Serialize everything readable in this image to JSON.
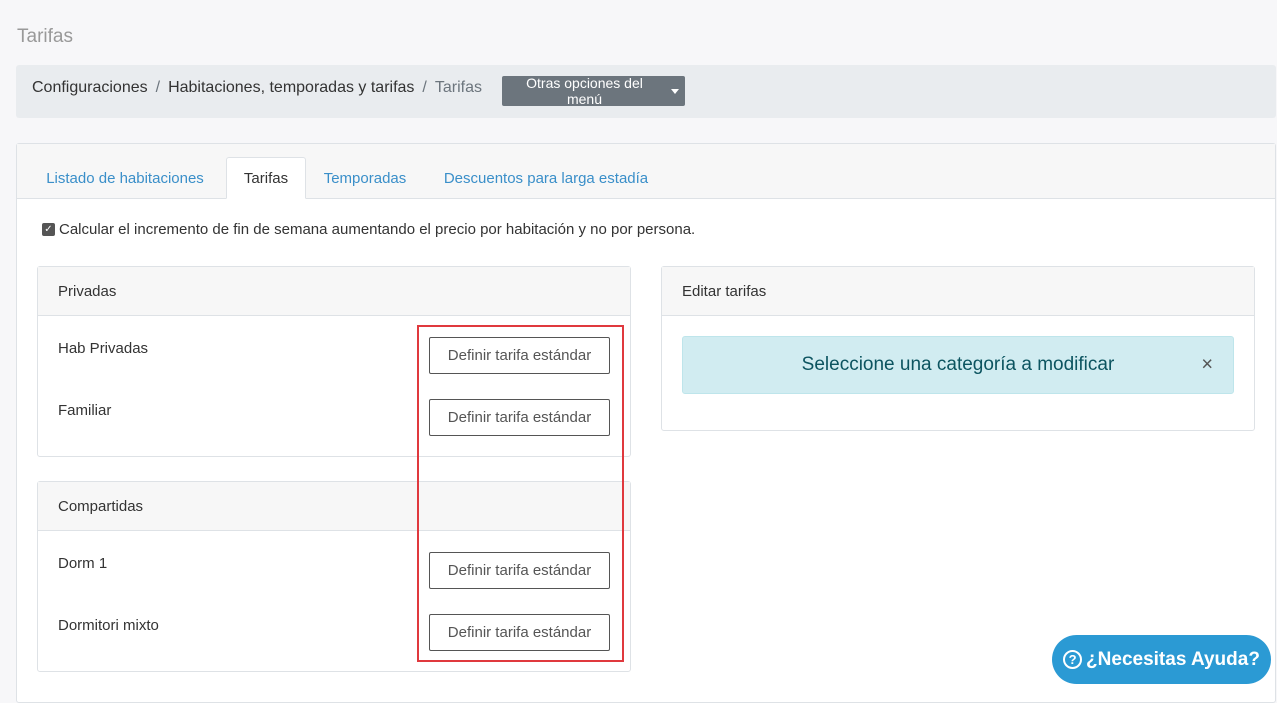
{
  "page": {
    "title": "Tarifas"
  },
  "breadcrumb": {
    "items": [
      "Configuraciones",
      "Habitaciones, temporadas y tarifas",
      "Tarifas"
    ],
    "separator": "/",
    "menu_button": "Otras opciones del menú"
  },
  "tabs": [
    {
      "label": "Listado de habitaciones",
      "active": false
    },
    {
      "label": "Tarifas",
      "active": true
    },
    {
      "label": "Temporadas",
      "active": false
    },
    {
      "label": "Descuentos para larga estadía",
      "active": false
    }
  ],
  "weekend_option": {
    "checked": true,
    "label": "Calcular el incremento de fin de semana aumentando el precio por habitación y no por persona."
  },
  "groups": [
    {
      "title": "Privadas",
      "rooms": [
        {
          "name": "Hab Privadas",
          "button": "Definir tarifa estándar"
        },
        {
          "name": "Familiar",
          "button": "Definir tarifa estándar"
        }
      ]
    },
    {
      "title": "Compartidas",
      "rooms": [
        {
          "name": "Dorm 1",
          "button": "Definir tarifa estándar"
        },
        {
          "name": "Dormitori mixto",
          "button": "Definir tarifa estándar"
        }
      ]
    }
  ],
  "edit_panel": {
    "title": "Editar tarifas",
    "alert": "Seleccione una categoría a modificar",
    "close_glyph": "×"
  },
  "help": {
    "label": "¿Necesitas Ayuda?",
    "icon": "question-circle-icon"
  },
  "colors": {
    "link": "#3a8fc9",
    "alert_bg": "#d1ecf1",
    "alert_text": "#0c5460",
    "highlight": "#e0393e",
    "help_bg": "#2b9ad4",
    "menu_button_bg": "#6c757d"
  }
}
